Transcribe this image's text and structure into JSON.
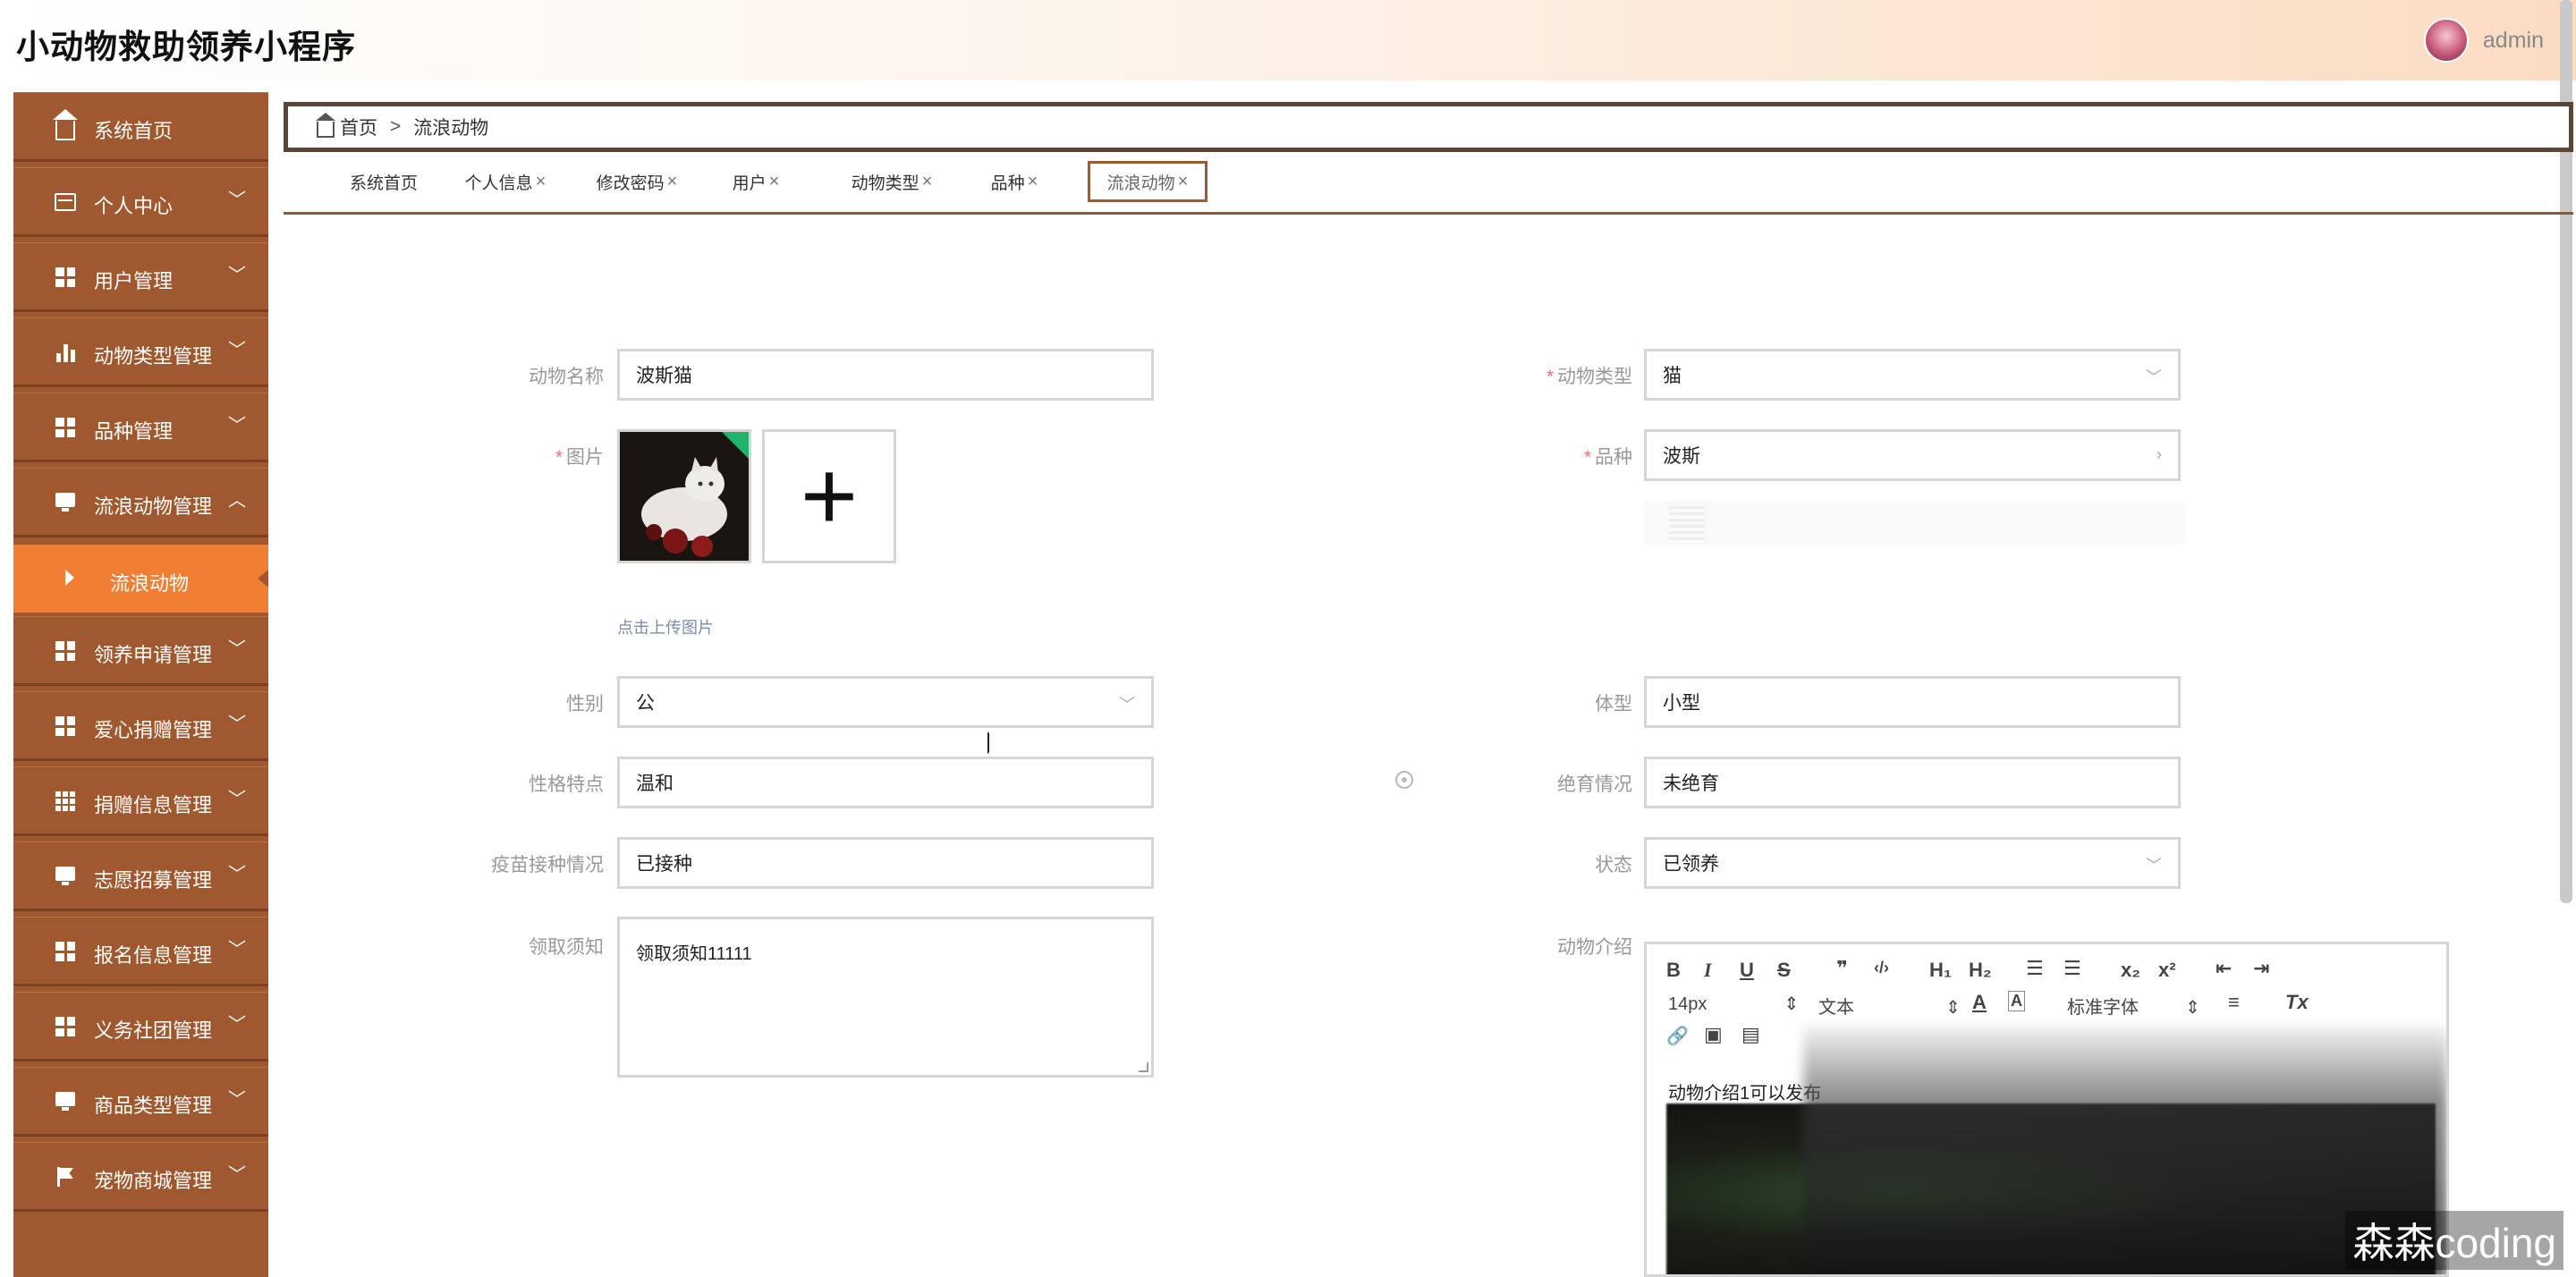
{
  "header": {
    "title": "小动物救助领养小程序",
    "username": "admin"
  },
  "sidebar": {
    "items": [
      {
        "label": "系统首页",
        "icon": "home-icon"
      },
      {
        "label": "个人中心",
        "icon": "card-icon",
        "arrow": "﹀"
      },
      {
        "label": "用户管理",
        "icon": "grid-icon",
        "arrow": "﹀"
      },
      {
        "label": "动物类型管理",
        "icon": "bar-chart-icon",
        "arrow": "﹀"
      },
      {
        "label": "品种管理",
        "icon": "grid-icon",
        "arrow": "﹀"
      },
      {
        "label": "流浪动物管理",
        "icon": "monitor-icon",
        "arrow": "︿"
      },
      {
        "label": "流浪动物",
        "icon": "caret-right-icon",
        "sub": true
      },
      {
        "label": "领养申请管理",
        "icon": "grid-icon",
        "arrow": "﹀"
      },
      {
        "label": "爱心捐赠管理",
        "icon": "grid-icon",
        "arrow": "﹀"
      },
      {
        "label": "捐赠信息管理",
        "icon": "grid-icon",
        "arrow": "﹀"
      },
      {
        "label": "志愿招募管理",
        "icon": "monitor-icon",
        "arrow": "﹀"
      },
      {
        "label": "报名信息管理",
        "icon": "grid-icon",
        "arrow": "﹀"
      },
      {
        "label": "义务社团管理",
        "icon": "grid-icon",
        "arrow": "﹀"
      },
      {
        "label": "商品类型管理",
        "icon": "monitor-icon",
        "arrow": "﹀"
      },
      {
        "label": "宠物商城管理",
        "icon": "flag-icon",
        "arrow": "﹀"
      }
    ]
  },
  "breadcrumb": {
    "home": "首页",
    "separator": ">",
    "current": "流浪动物"
  },
  "tabs": [
    {
      "label": "系统首页",
      "close": ""
    },
    {
      "label": "个人信息",
      "close": "×"
    },
    {
      "label": "修改密码",
      "close": "×"
    },
    {
      "label": "用户",
      "close": "×"
    },
    {
      "label": "动物类型",
      "close": "×"
    },
    {
      "label": "品种",
      "close": "×"
    },
    {
      "label": "流浪动物",
      "close": "×",
      "active": true
    }
  ],
  "form": {
    "name": {
      "label": "动物名称",
      "value": "波斯猫"
    },
    "type": {
      "label": "动物类型",
      "value": "猫",
      "required": "*"
    },
    "image": {
      "label": "图片",
      "required": "*",
      "upload_plus": "+",
      "upload_hint": "点击上传图片"
    },
    "breed": {
      "label": "品种",
      "value": "波斯",
      "required": "*"
    },
    "gender": {
      "label": "性别",
      "value": "公"
    },
    "size": {
      "label": "体型",
      "value": "小型"
    },
    "personality": {
      "label": "性格特点",
      "value": "温和"
    },
    "sterilization": {
      "label": "绝育情况",
      "value": "未绝育"
    },
    "vaccine": {
      "label": "疫苗接种情况",
      "value": "已接种"
    },
    "status": {
      "label": "状态",
      "value": "已领养"
    },
    "notice": {
      "label": "领取须知",
      "value": "领取须知11111"
    },
    "intro": {
      "label": "动物介绍",
      "body": "动物介绍1可以发布"
    }
  },
  "editor": {
    "bold": "B",
    "italic": "I",
    "underline": "U",
    "strike": "S",
    "quote": "❞",
    "code": "‹/›",
    "h1": "H₁",
    "h2": "H₂",
    "ol": "☰",
    "ul": "☰",
    "sub": "x₂",
    "sup": "x²",
    "outdent": "⇤",
    "indent": "⇥",
    "font_size": "14px",
    "font_format": "文本",
    "font_family": "标准字体",
    "color": "A",
    "bg_color": "A",
    "align": "≡",
    "clear": "Tx",
    "link": "🔗",
    "image": "▣",
    "video": "▤"
  },
  "watermark": "森森coding"
}
